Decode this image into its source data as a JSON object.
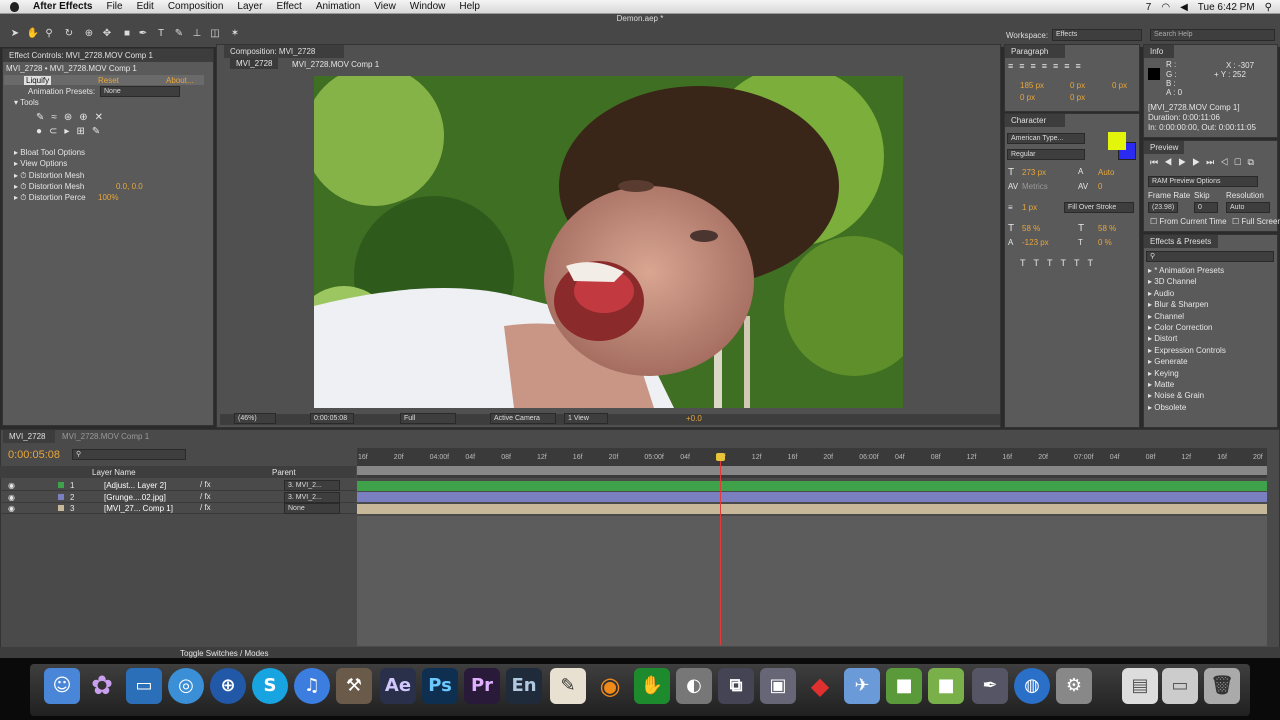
{
  "menubar": {
    "app": "After Effects",
    "items": [
      "File",
      "Edit",
      "Composition",
      "Layer",
      "Effect",
      "Animation",
      "View",
      "Window",
      "Help"
    ],
    "badge": "7",
    "clock": "Tue 6:42 PM"
  },
  "window": {
    "title": "Demon.aep *"
  },
  "toolbar": {
    "workspace_label": "Workspace:",
    "workspace": "Effects",
    "search_placeholder": "Search Help"
  },
  "effect_controls": {
    "tab": "Effect Controls: MVI_2728.MOV Comp 1",
    "path": "MVI_2728 • MVI_2728.MOV Comp 1",
    "effect": "Liquify",
    "reset": "Reset",
    "about": "About...",
    "presets_label": "Animation Presets:",
    "presets_value": "None",
    "tools": "Tools",
    "bloat": "Bloat Tool Options",
    "view": "View Options",
    "mesh1": "Distortion Mesh",
    "mesh2": "Distortion Mesh",
    "mesh2_value": "0.0, 0.0",
    "perc": "Distortion Perce",
    "perc_value": "100%"
  },
  "composition": {
    "tab": "Composition: MVI_2728",
    "sub1": "MVI_2728",
    "sub2": "MVI_2728.MOV Comp 1",
    "zoom": "(46%)",
    "time": "0:00:05:08",
    "resolution": "Full",
    "camera": "Active Camera",
    "views": "1 View",
    "exposure": "+0.0"
  },
  "paragraph": {
    "tab": "Paragraph",
    "v1": "185 px",
    "v2": "0 px",
    "v3": "0 px",
    "v4": "0 px",
    "v5": "0 px"
  },
  "character": {
    "tab": "Character",
    "font": "American Type...",
    "style": "Regular",
    "size": "273 px",
    "leading": "Auto",
    "kern": "Metrics",
    "track": "0",
    "stroke": "1 px",
    "stroke_mode": "Fill Over Stroke",
    "vscale": "58 %",
    "hscale": "58 %",
    "baseline": "-123 px",
    "tsume": "0 %",
    "fill_color": "#e2f50a",
    "stroke_color": "#2a2af0"
  },
  "info": {
    "tab": "Info",
    "r": "R :",
    "g": "G :",
    "b": "B :",
    "a": "A : 0",
    "x": "X : -307",
    "y": "+ Y : 252",
    "name": "[MVI_2728.MOV Comp 1]",
    "duration": "Duration: 0:00:11:06",
    "inout": "In: 0:00:00:00, Out: 0:00:11:05"
  },
  "preview": {
    "tab": "Preview",
    "ram": "RAM Preview Options",
    "fr_label": "Frame Rate",
    "skip_label": "Skip",
    "res_label": "Resolution",
    "fr": "(23.98)",
    "skip": "0",
    "res": "Auto",
    "from_current": "From Current Time",
    "full_screen": "Full Screen"
  },
  "effects_presets": {
    "tab": "Effects & Presets",
    "items": [
      "* Animation Presets",
      "3D Channel",
      "Audio",
      "Blur & Sharpen",
      "Channel",
      "Color Correction",
      "Distort",
      "Expression Controls",
      "Generate",
      "Keying",
      "Matte",
      "Noise & Grain",
      "Obsolete"
    ]
  },
  "timeline": {
    "tab1": "MVI_2728",
    "tab2": "MVI_2728.MOV Comp 1",
    "time": "0:00:05:08",
    "layer_col": "Layer Name",
    "parent_col": "Parent",
    "toggle": "Toggle Switches / Modes",
    "layers": [
      {
        "num": "1",
        "name": "[Adjust... Layer 2]",
        "parent": "3. MVI_2..."
      },
      {
        "num": "2",
        "name": "[Grunge....02.jpg]",
        "parent": "3. MVI_2..."
      },
      {
        "num": "3",
        "name": "[MVI_27... Comp 1]",
        "parent": "None"
      }
    ],
    "ticks": [
      "16f",
      "20f",
      "04:00f",
      "04f",
      "08f",
      "12f",
      "16f",
      "20f",
      "05:00f",
      "04f",
      "08f",
      "12f",
      "16f",
      "20f",
      "06:00f",
      "04f",
      "08f",
      "12f",
      "16f",
      "20f",
      "07:00f",
      "04f",
      "08f",
      "12f",
      "16f",
      "20f"
    ],
    "track_colors": [
      "#3fa24a",
      "#7a7fbf",
      "#c8b89a"
    ]
  },
  "dock": {
    "ae": "Ae",
    "ps": "Ps",
    "pr": "Pr",
    "en": "En"
  }
}
